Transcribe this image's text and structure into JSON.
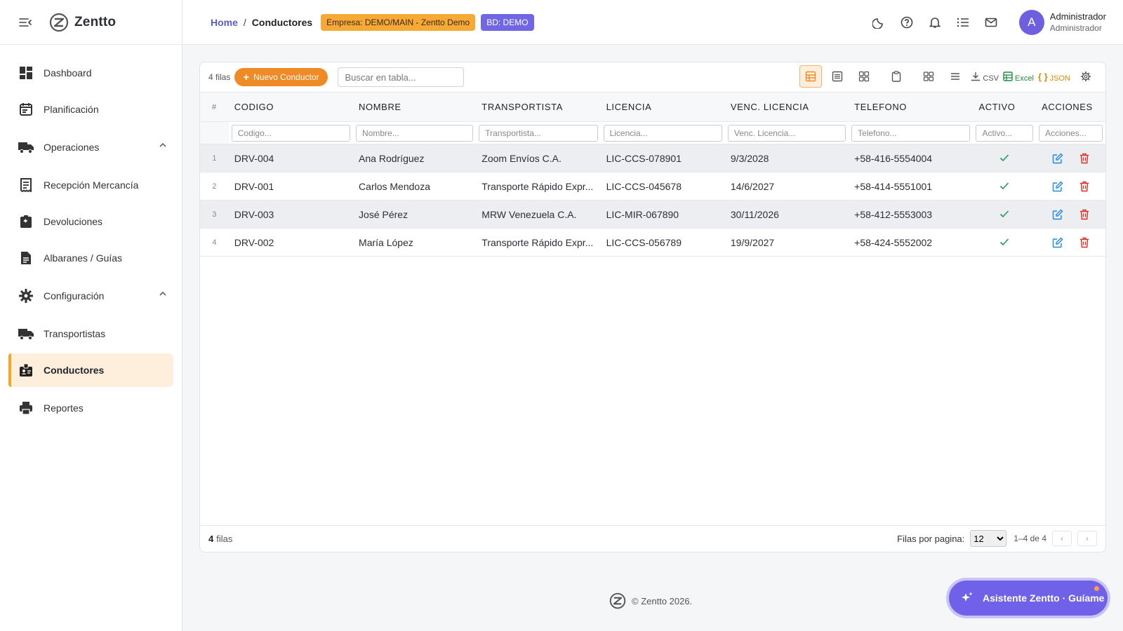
{
  "app": {
    "name": "Zentto"
  },
  "sidebar": {
    "items": [
      {
        "label": "Dashboard",
        "icon": "dashboard-icon"
      },
      {
        "label": "Planificación",
        "icon": "calendar-icon"
      },
      {
        "label": "Operaciones",
        "icon": "truck-icon",
        "expandable": true
      },
      {
        "label": "Recepción Mercancía",
        "icon": "receipt-icon"
      },
      {
        "label": "Devoluciones",
        "icon": "return-icon"
      },
      {
        "label": "Albaranes / Guías",
        "icon": "document-icon"
      },
      {
        "label": "Configuración",
        "icon": "gear-icon",
        "expandable": true
      },
      {
        "label": "Transportistas",
        "icon": "truck-icon"
      },
      {
        "label": "Conductores",
        "icon": "badge-icon",
        "active": true
      },
      {
        "label": "Reportes",
        "icon": "printer-icon"
      }
    ]
  },
  "topbar": {
    "breadcrumb": {
      "home": "Home",
      "separator": "/",
      "current": "Conductores"
    },
    "chip_empresa": "Empresa: DEMO/MAIN - Zentto Demo",
    "chip_bd": "BD: DEMO",
    "icons": [
      "moon-icon",
      "help-icon",
      "bell-icon",
      "list-icon",
      "mail-icon"
    ],
    "user": {
      "initial": "A",
      "name": "Administrador",
      "role": "Administrador"
    }
  },
  "grid": {
    "row_count_label": "4 filas",
    "new_button_label": "Nuevo Conductor",
    "search_placeholder": "Buscar en tabla...",
    "tools": {
      "csv_label": "CSV",
      "excel_label": "Excel",
      "json_label": "JSON",
      "excel_color": "#1e8e3e",
      "json_color": "#e08a00"
    },
    "columns": [
      {
        "key": "num",
        "label": "#"
      },
      {
        "key": "codigo",
        "label": "CODIGO",
        "filter": "Codigo..."
      },
      {
        "key": "nombre",
        "label": "NOMBRE",
        "filter": "Nombre..."
      },
      {
        "key": "transportista",
        "label": "TRANSPORTISTA",
        "filter": "Transportista..."
      },
      {
        "key": "licencia",
        "label": "LICENCIA",
        "filter": "Licencia..."
      },
      {
        "key": "venc",
        "label": "VENC. LICENCIA",
        "filter": "Venc. Licencia..."
      },
      {
        "key": "telefono",
        "label": "TELEFONO",
        "filter": "Telefono..."
      },
      {
        "key": "activo",
        "label": "ACTIVO",
        "filter": "Activo..."
      },
      {
        "key": "acciones",
        "label": "ACCIONES",
        "filter": "Acciones..."
      }
    ],
    "rows": [
      {
        "num": "1",
        "codigo": "DRV-004",
        "nombre": "Ana Rodríguez",
        "transportista": "Zoom Envíos C.A.",
        "licencia": "LIC-CCS-078901",
        "venc": "9/3/2028",
        "telefono": "+58-416-5554004",
        "activo": true
      },
      {
        "num": "2",
        "codigo": "DRV-001",
        "nombre": "Carlos Mendoza",
        "transportista": "Transporte Rápido Expr...",
        "licencia": "LIC-CCS-045678",
        "venc": "14/6/2027",
        "telefono": "+58-414-5551001",
        "activo": true
      },
      {
        "num": "3",
        "codigo": "DRV-003",
        "nombre": "José Pérez",
        "transportista": "MRW Venezuela C.A.",
        "licencia": "LIC-MIR-067890",
        "venc": "30/11/2026",
        "telefono": "+58-412-5553003",
        "activo": true
      },
      {
        "num": "4",
        "codigo": "DRV-002",
        "nombre": "María López",
        "transportista": "Transporte Rápido Expr...",
        "licencia": "LIC-CCS-056789",
        "venc": "19/9/2027",
        "telefono": "+58-424-5552002",
        "activo": true
      }
    ],
    "footer": {
      "count": "4",
      "count_suffix": "filas",
      "rows_per_page_label": "Filas por pagina:",
      "rows_per_page_value": "12",
      "range": "1–4 de 4"
    }
  },
  "footer": {
    "copyright": "© Zentto 2026."
  },
  "assistant": {
    "label": "Asistente Zentto · Guíame"
  },
  "colors": {
    "accent_orange": "#f08a24",
    "accent_purple": "#6f62e8",
    "check_green": "#1e9e5a",
    "edit_blue": "#1e88e5",
    "delete_red": "#d93025"
  }
}
